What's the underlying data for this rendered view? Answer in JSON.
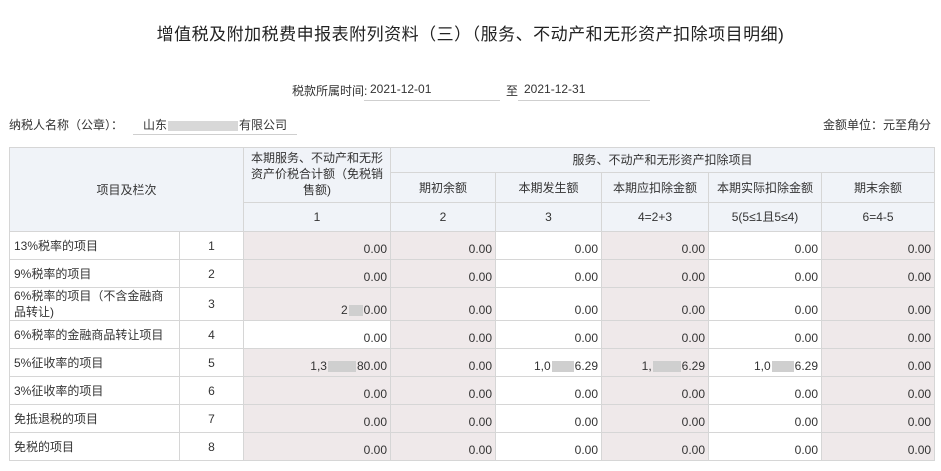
{
  "title": "增值税及附加税费申报表附列资料（三）（服务、不动产和无形资产扣除项目明细)",
  "period": {
    "label": "税款所属时间:",
    "start": "2021-12-01",
    "separator": "至",
    "end": "2021-12-31"
  },
  "taxpayer": {
    "label": "纳税人名称（公章）：",
    "name_prefix": "山东",
    "name_suffix": "有限公司"
  },
  "unit": "金额单位：元至角分",
  "headers": {
    "project": "项目及栏次",
    "col1": "本期服务、不动产和无形资产价税合计额（免税销售额)",
    "group": "服务、不动产和无形资产扣除项目",
    "col2": "期初余额",
    "col3": "本期发生额",
    "col4": "本期应扣除金额",
    "col5": "本期实际扣除金额",
    "col6": "期末余额",
    "formula1": "1",
    "formula2": "2",
    "formula3": "3",
    "formula4": "4=2+3",
    "formula5": "5(5≤1且5≤4)",
    "formula6": "6=4-5"
  },
  "rows": [
    {
      "name": "13%税率的项目",
      "line": "1",
      "c1": "0.00",
      "c2": "0.00",
      "c3": "0.00",
      "c4": "0.00",
      "c5": "0.00",
      "c6": "0.00"
    },
    {
      "name": "9%税率的项目",
      "line": "2",
      "c1": "0.00",
      "c2": "0.00",
      "c3": "0.00",
      "c4": "0.00",
      "c5": "0.00",
      "c6": "0.00"
    },
    {
      "name": "6%税率的项目（不含金融商品转让)",
      "line": "3",
      "c1a": "2",
      "c1b": "0.00",
      "c2": "0.00",
      "c3": "0.00",
      "c4": "0.00",
      "c5": "0.00",
      "c6": "0.00"
    },
    {
      "name": "6%税率的金融商品转让项目",
      "line": "4",
      "c1": "0.00",
      "c2": "0.00",
      "c3": "0.00",
      "c4": "0.00",
      "c5": "0.00",
      "c6": "0.00"
    },
    {
      "name": "5%征收率的项目",
      "line": "5",
      "c1a": "1,3",
      "c1b": "80.00",
      "c2": "0.00",
      "c3a": "1,0",
      "c3b": "6.29",
      "c4a": "1,",
      "c4b": "6.29",
      "c5a": "1,0",
      "c5b": "6.29",
      "c6": "0.00"
    },
    {
      "name": "3%征收率的项目",
      "line": "6",
      "c1": "0.00",
      "c2": "0.00",
      "c3": "0.00",
      "c4": "0.00",
      "c5": "0.00",
      "c6": "0.00"
    },
    {
      "name": "免抵退税的项目",
      "line": "7",
      "c1": "0.00",
      "c2": "0.00",
      "c3": "0.00",
      "c4": "0.00",
      "c5": "0.00",
      "c6": "0.00"
    },
    {
      "name": "免税的项目",
      "line": "8",
      "c1": "0.00",
      "c2": "0.00",
      "c3": "0.00",
      "c4": "0.00",
      "c5": "0.00",
      "c6": "0.00"
    }
  ]
}
